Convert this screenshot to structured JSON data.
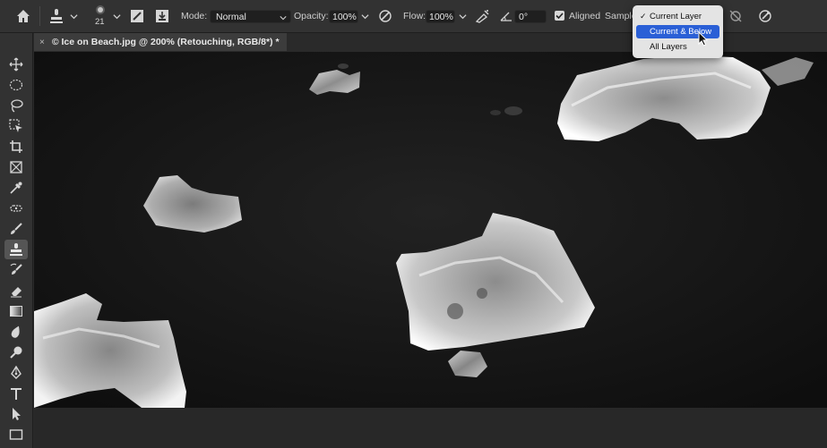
{
  "options_bar": {
    "brush_size": "21",
    "mode_label": "Mode:",
    "mode_value": "Normal",
    "opacity_label": "Opacity:",
    "opacity_value": "100%",
    "flow_label": "Flow:",
    "flow_value": "100%",
    "angle_value": "0°",
    "aligned_label": "Aligned",
    "aligned_checked": true,
    "sample_label": "Sample"
  },
  "document_tab": {
    "close_glyph": "×",
    "title": "© Ice on Beach.jpg @ 200% (Retouching, RGB/8*) *"
  },
  "toolbar": {
    "collapse_glyph": "››",
    "active_tool": "clone-stamp"
  },
  "sample_dropdown": {
    "items": [
      {
        "label": "Current Layer",
        "checked": true
      },
      {
        "label": "Current & Below",
        "highlighted": true
      },
      {
        "label": "All Layers"
      }
    ]
  },
  "colors": {
    "accent": "#2a5fd6",
    "panel": "#323232",
    "canvas": "#161616"
  }
}
